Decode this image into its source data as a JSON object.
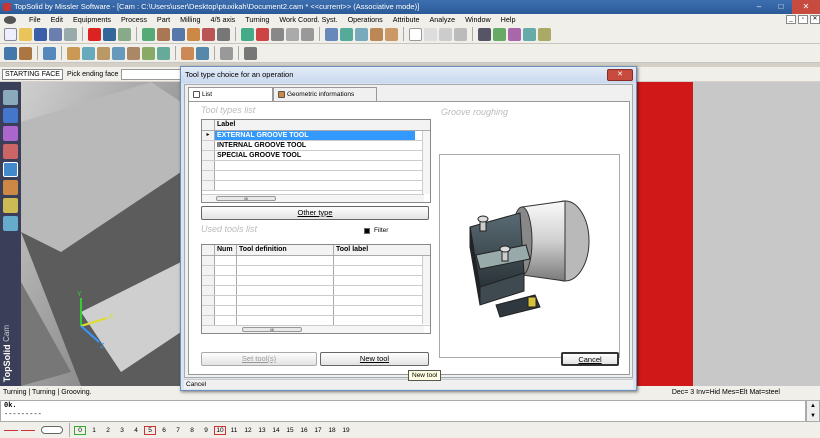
{
  "window": {
    "title": "TopSolid by Missler Software - [Cam : C:\\Users\\user\\Desktop\\ptuxikah\\Document2.cam *  <<current>> (Associative mode)]",
    "minimize": "–",
    "maximize": "□",
    "close": "✕"
  },
  "menu": [
    "File",
    "Edit",
    "Equipments",
    "Process",
    "Part",
    "Milling",
    "4/5 axis",
    "Turning",
    "Work Coord. Syst.",
    "Operations",
    "Attribute",
    "Analyze",
    "Window",
    "Help"
  ],
  "mdi_buttons": [
    "_",
    "▫",
    "✕"
  ],
  "command": {
    "name": "STARTING FACE",
    "prompt": "Pick ending face"
  },
  "left_toolbar": {
    "app_label": "TopSolid",
    "module_label": "Cam"
  },
  "status": {
    "breadcrumb": "Turning | Turning | Grooving.",
    "right": "Dec= 3    Inv=Hid   Mes=Elt   Mat=steel"
  },
  "console": {
    "line1": "0k.",
    "line2": "---------"
  },
  "layers": [
    "0",
    "1",
    "2",
    "3",
    "4",
    "5",
    "6",
    "7",
    "8",
    "9",
    "10",
    "11",
    "12",
    "13",
    "14",
    "15",
    "16",
    "17",
    "18",
    "19"
  ],
  "dialog": {
    "title": "Tool type choice for an operation",
    "close": "✕",
    "tabs": {
      "list": "List",
      "geometric": "Geometric informations"
    },
    "tool_types_title": "Tool types list",
    "tool_types_header": "Label",
    "tool_types": [
      "EXTERNAL GROOVE TOOL",
      "INTERNAL GROOVE TOOL",
      "SPECIAL GROOVE TOOL"
    ],
    "scroll_thumb": "III",
    "other_type_button": "Other type",
    "used_tools_title": "Used tools list",
    "filter_label": "Filter",
    "used_tools_headers": [
      "Num",
      "Tool definition",
      "Tool label"
    ],
    "set_tools_button": "Set tool(s)",
    "new_tool_button": "New tool",
    "preview_title": "Groove roughing",
    "cancel_button": "Cancel",
    "status": "Cancel",
    "tooltip": "New tool"
  },
  "colors": {
    "title_bar": "#2b5a98",
    "left_bar": "#3a3e58",
    "viewport_red": "#d01818",
    "selection": "#3399ff"
  }
}
